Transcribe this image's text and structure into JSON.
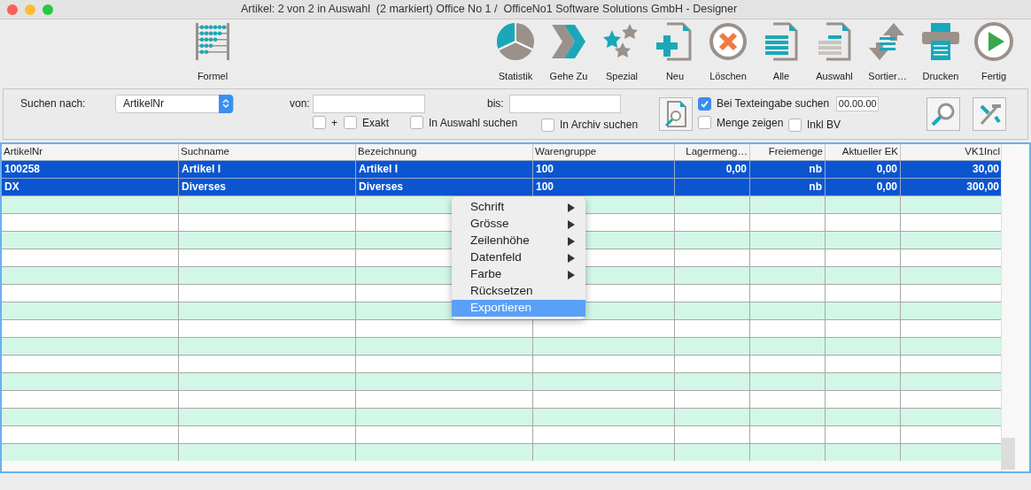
{
  "window": {
    "title": "Artikel: 2 von 2 in Auswahl  (2 markiert) Office No 1 /  OfficeNo1 Software Solutions GmbH - Designer"
  },
  "toolbar": [
    {
      "label": "Formel"
    },
    {
      "label": "Statistik"
    },
    {
      "label": "Gehe Zu"
    },
    {
      "label": "Spezial"
    },
    {
      "label": "Neu"
    },
    {
      "label": "Löschen"
    },
    {
      "label": "Alle"
    },
    {
      "label": "Auswahl"
    },
    {
      "label": "Sortier…"
    },
    {
      "label": "Drucken"
    },
    {
      "label": "Fertig"
    }
  ],
  "search": {
    "label": "Suchen nach:",
    "field": "ArtikelNr",
    "from_label": "von:",
    "to_label": "bis:",
    "options": [
      {
        "label": "+",
        "checked": false
      },
      {
        "label": "Exakt",
        "checked": false
      },
      {
        "label": "In Auswahl suchen",
        "checked": false
      },
      {
        "label": "In Archiv suchen",
        "checked": false
      },
      {
        "label": "Bei Texteingabe suchen",
        "checked": true
      },
      {
        "label": "Menge zeigen",
        "checked": false
      },
      {
        "label": "Inkl BV",
        "checked": false
      }
    ],
    "date": "00.00.00"
  },
  "table": {
    "columns": [
      {
        "label": "ArtikelNr"
      },
      {
        "label": "Suchname"
      },
      {
        "label": "Bezeichnung"
      },
      {
        "label": "Warengruppe"
      },
      {
        "label": "Lagermeng…"
      },
      {
        "label": "Freiemenge"
      },
      {
        "label": "Aktueller EK"
      },
      {
        "label": "VK1Incl"
      }
    ],
    "rows": [
      {
        "selected": true,
        "cells": [
          "100258",
          "Artikel I",
          "Artikel I",
          "100",
          "0,00",
          "nb",
          "0,00",
          "30,00"
        ]
      },
      {
        "selected": true,
        "cells": [
          "DX",
          "Diverses",
          "Diverses",
          "100",
          "",
          "nb",
          "0,00",
          "300,00"
        ]
      }
    ]
  },
  "context_menu": [
    {
      "label": "Schrift",
      "submenu": true,
      "selected": false
    },
    {
      "label": "Grösse",
      "submenu": true,
      "selected": false
    },
    {
      "label": "Zeilenhöhe",
      "submenu": true,
      "selected": false
    },
    {
      "label": "Datenfeld",
      "submenu": true,
      "selected": false
    },
    {
      "label": "Farbe",
      "submenu": true,
      "selected": false
    },
    {
      "label": "Rücksetzen",
      "submenu": false,
      "selected": false
    },
    {
      "label": "Exportieren",
      "submenu": false,
      "selected": true
    }
  ]
}
